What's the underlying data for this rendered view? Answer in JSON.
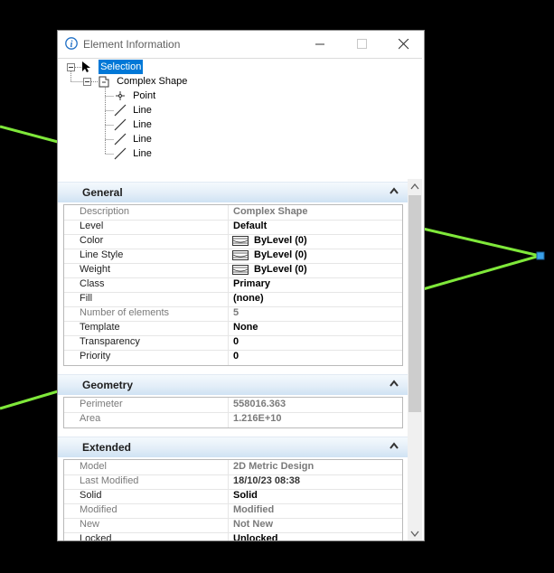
{
  "window": {
    "title": "Element Information"
  },
  "tree": {
    "root": "Selection",
    "child": "Complex Shape",
    "items": [
      "Point",
      "Line",
      "Line",
      "Line",
      "Line"
    ]
  },
  "sections": {
    "general": {
      "title": "General",
      "rows": [
        {
          "label": "Description",
          "value": "Complex Shape"
        },
        {
          "label": "Level",
          "value": "Default"
        },
        {
          "label": "Color",
          "value": "ByLevel (0)"
        },
        {
          "label": "Line Style",
          "value": "ByLevel (0)"
        },
        {
          "label": "Weight",
          "value": "ByLevel (0)"
        },
        {
          "label": "Class",
          "value": "Primary"
        },
        {
          "label": "Fill",
          "value": "(none)"
        },
        {
          "label": "Number of elements",
          "value": "5"
        },
        {
          "label": "Template",
          "value": "None"
        },
        {
          "label": "Transparency",
          "value": "0"
        },
        {
          "label": "Priority",
          "value": "0"
        }
      ]
    },
    "geometry": {
      "title": "Geometry",
      "rows": [
        {
          "label": "Perimeter",
          "value": "558016.363"
        },
        {
          "label": "Area",
          "value": "1.216E+10"
        }
      ]
    },
    "extended": {
      "title": "Extended",
      "rows": [
        {
          "label": "Model",
          "value": "2D Metric Design"
        },
        {
          "label": "Last Modified",
          "value": "18/10/23 08:38"
        },
        {
          "label": "Solid",
          "value": "Solid"
        },
        {
          "label": "Modified",
          "value": "Modified"
        },
        {
          "label": "New",
          "value": "Not New"
        },
        {
          "label": "Locked",
          "value": "Unlocked"
        }
      ]
    }
  },
  "colors": {
    "selection": "#0078d7",
    "canvas": "#000000",
    "element_line": "#7fe83a",
    "handle": "#3aa0e8"
  }
}
